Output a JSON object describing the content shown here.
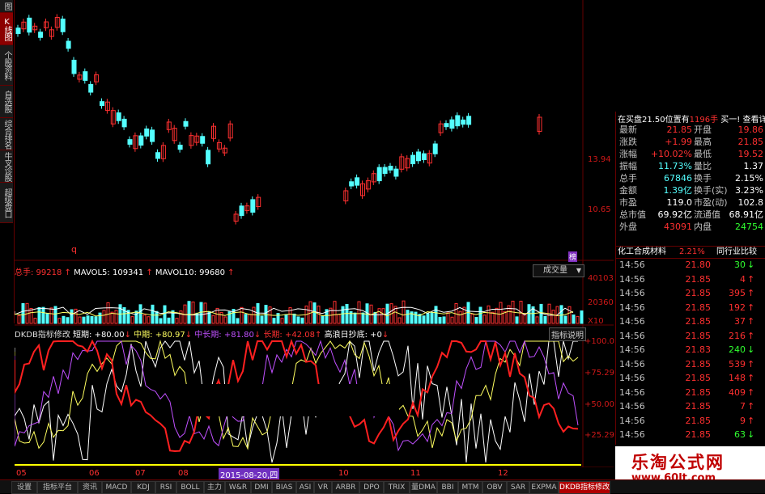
{
  "sidebar": {
    "tabs": [
      "图",
      "K线图",
      "个股资料",
      "自选股",
      "综合排名",
      "牛叉诊股",
      "超级盘口"
    ],
    "active": 1
  },
  "kline": {
    "price_labels": [
      "13.94",
      "10.65"
    ],
    "marker": "q",
    "badge": "榜"
  },
  "volume": {
    "header": {
      "zongshou": "总手: 99218",
      "mavol5": "MAVOL5: 109341",
      "mavol10": "MAVOL10: 99680"
    },
    "dropdown": "成交量",
    "labels": [
      "40103",
      "20360",
      "X10"
    ]
  },
  "indicator": {
    "header": {
      "name": "DKDB指标修改",
      "short": "短期: +80.00",
      "mid": "中期: +80.97",
      "midlong": "中长期: +81.80",
      "long": "长期: +42.08",
      "bottom": "高浪日抄底: +0"
    },
    "help": "指标说明",
    "labels": [
      "+100.0",
      "+75.29",
      "+50.00",
      "+25.29"
    ]
  },
  "x_axis": {
    "labels": [
      "05",
      "06",
      "07",
      "08",
      "10",
      "11",
      "12"
    ],
    "highlight": "2015-08-20,四"
  },
  "quote": {
    "header": {
      "buy_info": "在买盘21.50位置有",
      "qty": "1196手",
      "buy1": "买一!",
      "detail": "查看详细"
    },
    "rows": [
      {
        "l1": "最新",
        "v1": "21.85",
        "l2": "开盘",
        "v2": "19.86"
      },
      {
        "l1": "涨跌",
        "v1": "+1.99",
        "l2": "最高",
        "v2": "21.85"
      },
      {
        "l1": "涨幅",
        "v1": "+10.02%",
        "l2": "最低",
        "v2": "19.52"
      },
      {
        "l1": "振幅",
        "v1": "11.73%",
        "l2": "量比",
        "v2": "1.37"
      },
      {
        "l1": "总手",
        "v1": "67846",
        "l2": "换手",
        "v2": "2.15%"
      },
      {
        "l1": "金额",
        "v1": "1.39亿",
        "l2": "换手(实)",
        "v2": "3.23%"
      },
      {
        "l1": "市盈",
        "v1": "119.0",
        "l2": "市盈(动)",
        "v2": "102.8"
      },
      {
        "l1": "总市值",
        "v1": "69.92亿",
        "l2": "流通值",
        "v2": "68.91亿"
      },
      {
        "l1": "外盘",
        "v1": "43091",
        "l2": "内盘",
        "v2": "24754"
      }
    ],
    "industry": {
      "name": "化工合成材料",
      "pct": "2.21%",
      "compare": "同行业比较"
    },
    "ticks": [
      {
        "time": "14:56",
        "price": "21.80",
        "vol": "30",
        "dir": "down"
      },
      {
        "time": "14:56",
        "price": "21.85",
        "vol": "4",
        "dir": "up"
      },
      {
        "time": "14:56",
        "price": "21.85",
        "vol": "395",
        "dir": "up"
      },
      {
        "time": "14:56",
        "price": "21.85",
        "vol": "192",
        "dir": "up"
      },
      {
        "time": "14:56",
        "price": "21.85",
        "vol": "37",
        "dir": "up"
      },
      {
        "time": "14:56",
        "price": "21.85",
        "vol": "216",
        "dir": "up"
      },
      {
        "time": "14:56",
        "price": "21.83",
        "vol": "240",
        "dir": "down"
      },
      {
        "time": "14:56",
        "price": "21.85",
        "vol": "539",
        "dir": "up"
      },
      {
        "time": "14:56",
        "price": "21.85",
        "vol": "148",
        "dir": "up"
      },
      {
        "time": "14:56",
        "price": "21.85",
        "vol": "409",
        "dir": "up"
      },
      {
        "time": "14:56",
        "price": "21.85",
        "vol": "7",
        "dir": "up"
      },
      {
        "time": "14:56",
        "price": "21.85",
        "vol": "9",
        "dir": "up"
      },
      {
        "time": "14:56",
        "price": "21.85",
        "vol": "63",
        "dir": "down"
      }
    ]
  },
  "bottom_tabs": [
    "设置",
    "指标平台",
    "资讯",
    "MACD",
    "KDJ",
    "RSI",
    "BOLL",
    "主力",
    "W&R",
    "DMI",
    "BIAS",
    "ASI",
    "VR",
    "ARBR",
    "DPO",
    "TRIX",
    "量DMA",
    "BBI",
    "MTM",
    "OBV",
    "SAR",
    "EXPMA",
    "DKDB指标修改"
  ],
  "watermark": {
    "title": "乐淘公式网",
    "url": "www.60lt.com"
  },
  "colors": {
    "up": "#ff3030",
    "down": "#54ffff",
    "border": "#660000",
    "accent": "#ff2020",
    "watermark_red": "#c00000"
  }
}
